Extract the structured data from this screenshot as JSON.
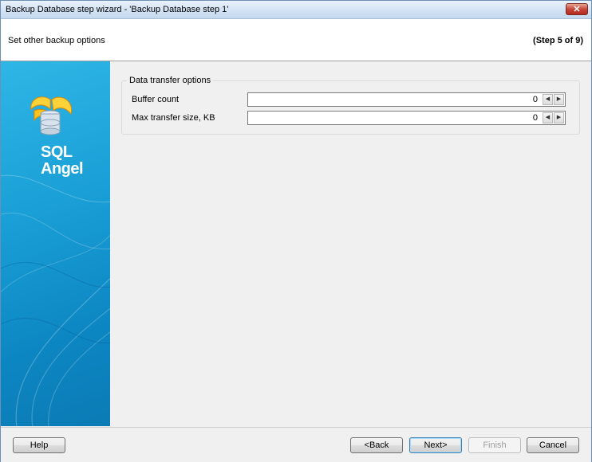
{
  "window": {
    "title": "Backup Database step wizard - 'Backup Database step 1'",
    "close_glyph": "✕"
  },
  "header": {
    "subtitle": "Set other backup options",
    "step": "(Step 5 of 9)"
  },
  "sidebar": {
    "logo_line1": "SQL",
    "logo_line2": "Angel",
    "icon": "sql-angel-logo-icon"
  },
  "group": {
    "legend": "Data transfer options",
    "fields": [
      {
        "label": "Buffer count",
        "value": "0"
      },
      {
        "label": "Max transfer size, KB",
        "value": "0"
      }
    ]
  },
  "buttons": {
    "help": "Help",
    "back": "<Back",
    "next": "Next>",
    "finish": "Finish",
    "cancel": "Cancel"
  },
  "colors": {
    "sidebar_blue": "#1a9fd6",
    "title_bar": "#d3e3f5",
    "close_red": "#c7473a"
  }
}
